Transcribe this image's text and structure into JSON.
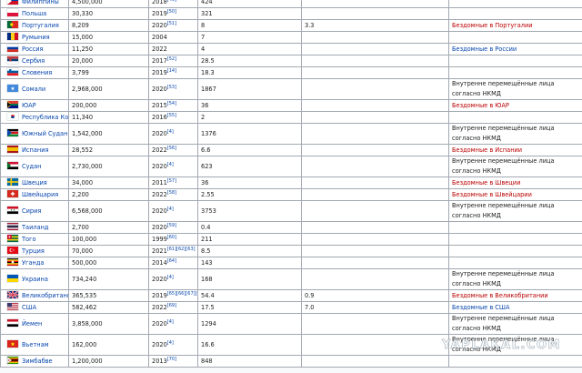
{
  "columns": [
    "country",
    "population",
    "year",
    "per_10000",
    "percent",
    "notes"
  ],
  "rows": [
    {
      "flag": "philippines",
      "country": "Филиппины",
      "population": "4,500,000",
      "year": "2018",
      "ref": "[49]",
      "per_10000": "424",
      "percent": "",
      "note": "",
      "note_style": ""
    },
    {
      "flag": "poland",
      "country": "Польша",
      "population": "30,330",
      "year": "2019",
      "ref": "[50]",
      "per_10000": "321",
      "percent": "",
      "note": "",
      "note_style": ""
    },
    {
      "flag": "portugal",
      "country": "Португалия",
      "population": "8,209",
      "year": "2020",
      "ref": "[51]",
      "per_10000": "8",
      "percent": "3.3",
      "note": "Бездомные в Португалии",
      "note_style": "red"
    },
    {
      "flag": "romania",
      "country": "Румыния",
      "population": "15,000",
      "year": "2004",
      "ref": "",
      "per_10000": "7",
      "percent": "",
      "note": "",
      "note_style": ""
    },
    {
      "flag": "russia",
      "country": "Россия",
      "population": "11,250",
      "year": "2022",
      "ref": "",
      "per_10000": "4",
      "percent": "",
      "note": "Бездомные в России",
      "note_style": "link"
    },
    {
      "flag": "serbia",
      "country": "Сербия",
      "population": "20,000",
      "year": "2017",
      "ref": "[52]",
      "per_10000": "28.5",
      "percent": "",
      "note": "",
      "note_style": ""
    },
    {
      "flag": "slovenia",
      "country": "Словения",
      "population": "3,799",
      "year": "2019",
      "ref": "[14]",
      "per_10000": "18.3",
      "percent": "",
      "note": "",
      "note_style": ""
    },
    {
      "flag": "somalia",
      "country": "Сомали",
      "population": "2,968,000",
      "year": "2020",
      "ref": "[53]",
      "per_10000": "1867",
      "percent": "",
      "note": "Внутренне перемещённые лица согласно НКМД",
      "note_style": "plain"
    },
    {
      "flag": "south_africa",
      "country": "ЮАР",
      "population": "200,000",
      "year": "2015",
      "ref": "[54]",
      "per_10000": "36",
      "percent": "",
      "note": "Бездомные в ЮАР",
      "note_style": "red"
    },
    {
      "flag": "south_korea",
      "country": "Республика Корея",
      "population": "11,340",
      "year": "2016",
      "ref": "[55]",
      "per_10000": "2",
      "percent": "",
      "note": "",
      "note_style": ""
    },
    {
      "flag": "south_sudan",
      "country": "Южный Судан",
      "population": "1,542,000",
      "year": "2020",
      "ref": "[4]",
      "per_10000": "1376",
      "percent": "",
      "note": "Внутренне перемещённые лица согласно НКМД",
      "note_style": "plain"
    },
    {
      "flag": "spain",
      "country": "Испания",
      "population": "28,552",
      "year": "2022",
      "ref": "[56]",
      "per_10000": "6.6",
      "percent": "",
      "note": "Бездомные в Испании",
      "note_style": "red"
    },
    {
      "flag": "sudan",
      "country": "Судан",
      "population": "2,730,000",
      "year": "2020",
      "ref": "[4]",
      "per_10000": "623",
      "percent": "",
      "note": "Внутренне перемещённые лица согласно НКМД",
      "note_style": "plain"
    },
    {
      "flag": "sweden",
      "country": "Швеция",
      "population": "34,000",
      "year": "2011",
      "ref": "[57]",
      "per_10000": "36",
      "percent": "",
      "note": "Бездомные в Швеции",
      "note_style": "red"
    },
    {
      "flag": "switzerland",
      "country": "Швейцария",
      "population": "2,200",
      "year": "2022",
      "ref": "[58]",
      "per_10000": "2.55",
      "percent": "",
      "note": "Бездомные в Швейцарии",
      "note_style": "red"
    },
    {
      "flag": "syria",
      "country": "Сирия",
      "population": "6,568,000",
      "year": "2020",
      "ref": "[4]",
      "per_10000": "3753",
      "percent": "",
      "note": "Внутренне перемещённые лица согласно НКМД",
      "note_style": "plain"
    },
    {
      "flag": "thailand",
      "country": "Таиланд",
      "population": "2,700",
      "year": "2020",
      "ref": "[59]",
      "per_10000": "0.4",
      "percent": "",
      "note": "",
      "note_style": ""
    },
    {
      "flag": "togo",
      "country": "Того",
      "population": "100,000",
      "year": "1999",
      "ref": "[60]",
      "per_10000": "211",
      "percent": "",
      "note": "",
      "note_style": ""
    },
    {
      "flag": "turkey",
      "country": "Турция",
      "population": "70,000",
      "year": "2021",
      "ref": "[61][62][63]",
      "per_10000": "8.5",
      "percent": "",
      "note": "",
      "note_style": ""
    },
    {
      "flag": "uganda",
      "country": "Уганда",
      "population": "500,000",
      "year": "2014",
      "ref": "[64]",
      "per_10000": "143",
      "percent": "",
      "note": "",
      "note_style": ""
    },
    {
      "flag": "ukraine",
      "country": "Украина",
      "population": "734,240",
      "year": "2020",
      "ref": "[4]",
      "per_10000": "168",
      "percent": "",
      "note": "Внутренне перемещённые лица согласно НКМД",
      "note_style": "plain"
    },
    {
      "flag": "uk",
      "country": "Великобритания",
      "population": "365,535",
      "year": "2019",
      "ref": "[65][66][67][68]",
      "per_10000": "54.4",
      "percent": "0.9",
      "note": "Бездомные в Великобритании",
      "note_style": "red"
    },
    {
      "flag": "usa",
      "country": "США",
      "population": "582,462",
      "year": "2022",
      "ref": "[69]",
      "per_10000": "17.5",
      "percent": "7.0",
      "note": "Бездомные в США",
      "note_style": "link"
    },
    {
      "flag": "yemen",
      "country": "Йемен",
      "population": "3,858,000",
      "year": "2020",
      "ref": "[4]",
      "per_10000": "1294",
      "percent": "",
      "note": "Внутренне перемещённые лица согласно НКМД",
      "note_style": "plain"
    },
    {
      "flag": "vietnam",
      "country": "Вьетнам",
      "population": "162,000",
      "year": "2020",
      "ref": "[4]",
      "per_10000": "16.6",
      "percent": "",
      "note": "Внутренне перемещённые лица согласно НКМД",
      "note_style": "plain"
    },
    {
      "flag": "zimbabwe",
      "country": "Зимбабве",
      "population": "1,200,000",
      "year": "2013",
      "ref": "[70]",
      "per_10000": "848",
      "percent": "",
      "note": "",
      "note_style": ""
    }
  ],
  "watermark": "YAPLAKAL.COM",
  "colors": {
    "link": "#0645ad",
    "red_link": "#ba0000",
    "border": "#a2a9b1",
    "text": "#202122",
    "background": "#f8f9fa"
  }
}
